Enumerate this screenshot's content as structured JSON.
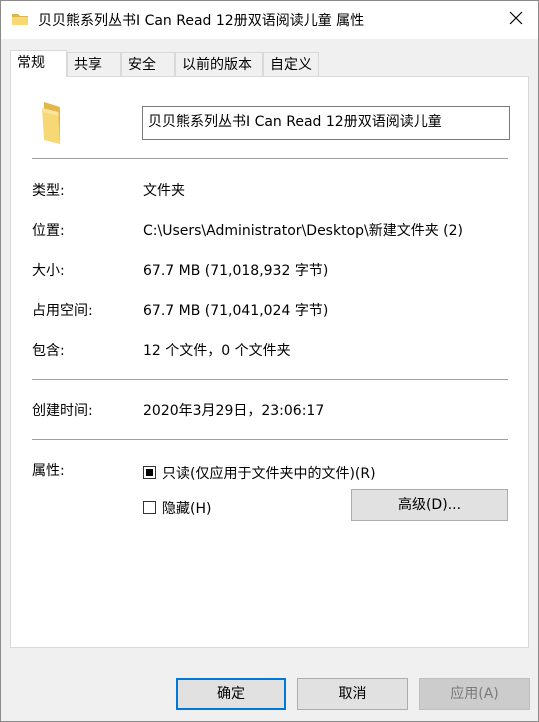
{
  "window": {
    "title": "贝贝熊系列丛书I Can Read 12册双语阅读儿童 属性",
    "close_icon": "close-icon"
  },
  "tabs": [
    {
      "label": "常规",
      "active": true
    },
    {
      "label": "共享"
    },
    {
      "label": "安全"
    },
    {
      "label": "以前的版本"
    },
    {
      "label": "自定义"
    }
  ],
  "general": {
    "folder_name": "贝贝熊系列丛书I Can Read 12册双语阅读儿童",
    "type_label": "类型:",
    "type_value": "文件夹",
    "location_label": "位置:",
    "location_value": "C:\\Users\\Administrator\\Desktop\\新建文件夹 (2)",
    "size_label": "大小:",
    "size_value": "67.7 MB (71,018,932 字节)",
    "disk_label": "占用空间:",
    "disk_value": "67.7 MB (71,041,024 字节)",
    "contains_label": "包含:",
    "contains_value": "12 个文件，0 个文件夹",
    "created_label": "创建时间:",
    "created_value": "2020年3月29日，23:06:17",
    "attributes_label": "属性:",
    "readonly_label": "只读(仅应用于文件夹中的文件)(R)",
    "readonly_state": "indeterminate",
    "hidden_label": "隐藏(H)",
    "hidden_checked": false,
    "advanced_label": "高级(D)..."
  },
  "footer": {
    "ok_label": "确定",
    "cancel_label": "取消",
    "apply_label": "应用(A)"
  },
  "colors": {
    "accent": "#0078d7",
    "folder": "#f8d775"
  }
}
